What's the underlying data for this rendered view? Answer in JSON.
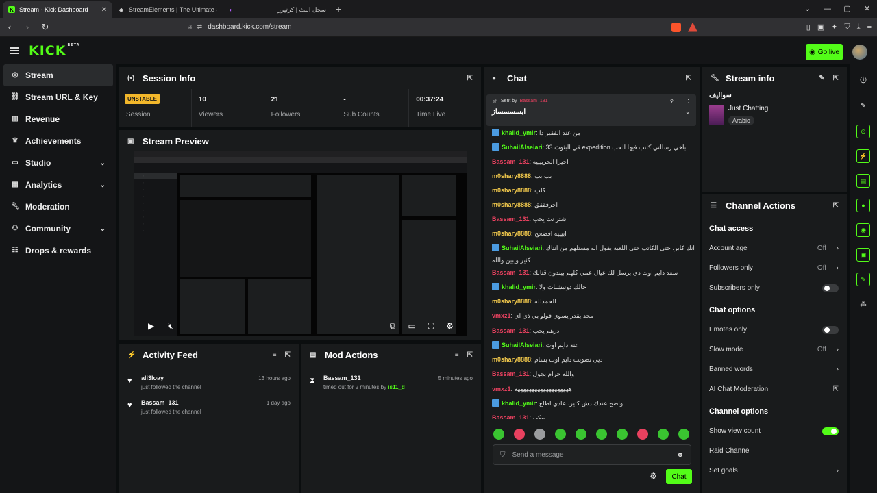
{
  "browser": {
    "tabs": [
      {
        "label": "Stream - Kick Dashboard"
      },
      {
        "label": "StreamElements | The Ultimate Strea"
      },
      {
        "label": "سجل البث | كرتيرز"
      }
    ],
    "url": "dashboard.kick.com/stream"
  },
  "topnav": {
    "logo": "KICK",
    "logo_sup": "BETA",
    "go_live": "Go live"
  },
  "sidebar": {
    "items": [
      {
        "label": "Stream",
        "icon": "broadcast-icon"
      },
      {
        "label": "Stream URL & Key",
        "icon": "link-icon"
      },
      {
        "label": "Revenue",
        "icon": "chart-icon"
      },
      {
        "label": "Achievements",
        "icon": "trophy-icon"
      },
      {
        "label": "Studio",
        "icon": "studio-icon"
      },
      {
        "label": "Analytics",
        "icon": "analytics-icon"
      },
      {
        "label": "Moderation",
        "icon": "wrench-icon"
      },
      {
        "label": "Community",
        "icon": "people-icon"
      },
      {
        "label": "Drops & rewards",
        "icon": "gift-icon"
      }
    ]
  },
  "session": {
    "title": "Session Info",
    "badge": "UNSTABLE",
    "stats": [
      {
        "value": "",
        "label": "Session"
      },
      {
        "value": "10",
        "label": "Viewers"
      },
      {
        "value": "21",
        "label": "Followers"
      },
      {
        "value": "-",
        "label": "Sub Counts"
      },
      {
        "value": "00:37:24",
        "label": "Time Live"
      }
    ]
  },
  "preview": {
    "title": "Stream Preview"
  },
  "activity": {
    "title": "Activity Feed",
    "items": [
      {
        "name": "ali3loay",
        "action": "just followed the channel",
        "time": "13 hours ago"
      },
      {
        "name": "Bassam_131",
        "action": "just followed the channel",
        "time": "1 day ago"
      }
    ]
  },
  "mod": {
    "title": "Mod Actions",
    "items": [
      {
        "name": "Bassam_131",
        "action": "timed out for 2 minutes by",
        "by": "is11_d",
        "time": "5 minutes ago"
      }
    ]
  },
  "chat": {
    "title": "Chat",
    "pinned": {
      "prefix": "Sent by",
      "user": "Bassam_131",
      "message": "ابسسسساز"
    },
    "messages": [
      {
        "user": "khalid_ymir",
        "color": "#53fc18",
        "verified": true,
        "text": "من عند الفقير دا"
      },
      {
        "user": "SuhailAlseiari",
        "color": "#53fc18",
        "verified": true,
        "text": "في البثوث 33 expedition باخي رسالتي كانب فيها الحب"
      },
      {
        "user": "Bassam_131",
        "color": "#e8415f",
        "verified": false,
        "text": "اخيرا الحرييييه"
      },
      {
        "user": "m0shary8888",
        "color": "#f2c94c",
        "verified": false,
        "text": "بب بب"
      },
      {
        "user": "m0shary8888",
        "color": "#f2c94c",
        "verified": false,
        "text": "كلب"
      },
      {
        "user": "m0shary8888",
        "color": "#f2c94c",
        "verified": false,
        "text": "احرقققق"
      },
      {
        "user": "Bassam_131",
        "color": "#e8415f",
        "verified": false,
        "text": "اشتر نت يحب"
      },
      {
        "user": "m0shary8888",
        "color": "#f2c94c",
        "verified": false,
        "text": "ابيييه افضحح"
      },
      {
        "user": "SuhailAlseiari",
        "color": "#53fc18",
        "verified": true,
        "text": "تشبه انك كابر، حتى الكاتب حتى اللعبة يقول انه مستلهم من انتاك"
      },
      {
        "user": "",
        "color": "#ddd",
        "verified": false,
        "text": "كثير ويبين والله"
      },
      {
        "user": "Bassam_131",
        "color": "#e8415f",
        "verified": false,
        "text": "سعد دايم اوت ذي برسل لك عيال عمي كلهم بيندون قتالك"
      },
      {
        "user": "khalid_ymir",
        "color": "#53fc18",
        "verified": true,
        "text": "جالك دونيشنات ولا"
      },
      {
        "user": "m0shary8888",
        "color": "#f2c94c",
        "verified": false,
        "text": "الحمدلله"
      },
      {
        "user": "vmxz1",
        "color": "#e8415f",
        "verified": false,
        "text": "محد يقدر يسوي فولو بي ذي اي"
      },
      {
        "user": "Bassam_131",
        "color": "#e8415f",
        "verified": false,
        "text": "درهم يحب"
      },
      {
        "user": "SuhailAlseiari",
        "color": "#53fc18",
        "verified": true,
        "text": "عنه دايم اوت"
      },
      {
        "user": "m0shary8888",
        "color": "#f2c94c",
        "verified": false,
        "text": "ديي تصويت دايم اوت بسام"
      },
      {
        "user": "Bassam_131",
        "color": "#e8415f",
        "verified": false,
        "text": "والله حرام يجول"
      },
      {
        "user": "vmxz1",
        "color": "#e8415f",
        "verified": false,
        "text": "هههههههههههههههههههه"
      },
      {
        "user": "khalid_ymir",
        "color": "#53fc18",
        "verified": true,
        "text": "واضح عندك دش كثير، عادي اطلع"
      },
      {
        "user": "Bassam_131",
        "color": "#e8415f",
        "verified": false,
        "text": "بيكي"
      }
    ],
    "placeholder": "Send a message",
    "send_label": "Chat"
  },
  "stream_info": {
    "title": "Stream info",
    "stream_title": "سواليف",
    "category": "Just Chatting",
    "tag": "Arabic"
  },
  "channel_actions": {
    "title": "Channel Actions",
    "chat_access_title": "Chat access",
    "chat_access": [
      {
        "label": "Account age",
        "value": "Off",
        "kind": "arrow"
      },
      {
        "label": "Followers only",
        "value": "Off",
        "kind": "arrow"
      },
      {
        "label": "Subscribers only",
        "value": "",
        "kind": "toggle-off"
      }
    ],
    "chat_options_title": "Chat options",
    "chat_options": [
      {
        "label": "Emotes only",
        "value": "",
        "kind": "toggle-off"
      },
      {
        "label": "Slow mode",
        "value": "Off",
        "kind": "arrow"
      },
      {
        "label": "Banned words",
        "value": "",
        "kind": "arrow"
      },
      {
        "label": "AI Chat Moderation",
        "value": "",
        "kind": "external"
      }
    ],
    "channel_options_title": "Channel options",
    "channel_options": [
      {
        "label": "Show view count",
        "value": "",
        "kind": "toggle-on"
      },
      {
        "label": "Raid Channel",
        "value": "",
        "kind": "none"
      },
      {
        "label": "Set goals",
        "value": "",
        "kind": "arrow"
      }
    ]
  },
  "colors": {
    "accent": "#53fc18",
    "warning": "#f2b72b",
    "panel": "#191b1c",
    "background": "#0b0e0f"
  }
}
